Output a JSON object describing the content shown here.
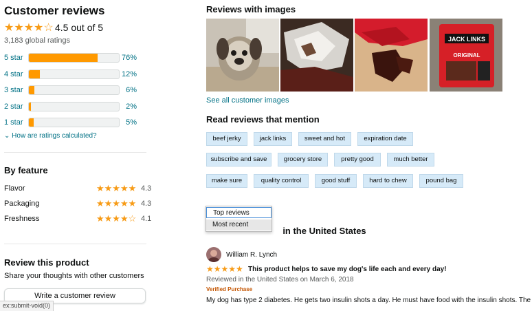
{
  "header": {
    "title": "Customer reviews"
  },
  "overall": {
    "stars_glyph": "★★★★☆",
    "text": "4.5 out of 5",
    "rating": 4.5,
    "global_ratings": "3,183 global ratings"
  },
  "histogram": [
    {
      "label": "5 star",
      "pct_text": "76%",
      "pct": 76
    },
    {
      "label": "4 star",
      "pct_text": "12%",
      "pct": 12
    },
    {
      "label": "3 star",
      "pct_text": "6%",
      "pct": 6
    },
    {
      "label": "2 star",
      "pct_text": "2%",
      "pct": 2
    },
    {
      "label": "1 star",
      "pct_text": "5%",
      "pct": 5
    }
  ],
  "how_link": "How are ratings calculated?",
  "by_feature": {
    "title": "By feature",
    "items": [
      {
        "name": "Flavor",
        "stars_glyph": "★★★★★",
        "score": "4.3"
      },
      {
        "name": "Packaging",
        "stars_glyph": "★★★★★",
        "score": "4.3"
      },
      {
        "name": "Freshness",
        "stars_glyph": "★★★★☆",
        "score": "4.1"
      }
    ]
  },
  "review_product": {
    "title": "Review this product",
    "subtitle": "Share your thoughts with other customers",
    "button": "Write a customer review"
  },
  "status_bar": {
    "text": "ex:submit-void(0)"
  },
  "images_section": {
    "title": "Reviews with images",
    "see_all": "See all customer images"
  },
  "mentions": {
    "title": "Read reviews that mention",
    "chips": [
      "beef jerky",
      "jack links",
      "sweet and hot",
      "expiration date",
      "subscribe and save",
      "grocery store",
      "pretty good",
      "much better",
      "make sure",
      "quality control",
      "good stuff",
      "hard to chew",
      "pound bag"
    ]
  },
  "sort_dropdown": {
    "options": [
      "Top reviews",
      "Most recent"
    ],
    "selected": "Top reviews"
  },
  "top_reviews_heading": "Top reviews from the United States",
  "top_reviews_visible_part": "in the United States",
  "review": {
    "reviewer": "William R. Lynch",
    "stars_glyph": "★★★★★",
    "title": "This product helps to save my dog's life each and every day!",
    "date": "Reviewed in the United States on March 6, 2018",
    "verified": "Verified Purchase",
    "body": "My dog has type 2 diabetes. He gets two insulin shots a day. He must have food with the insulin shots. The"
  },
  "colors": {
    "accent_link": "#007185",
    "star": "#f79b16",
    "bar_fill": "#ff9900",
    "chip_bg": "#d6eaf8",
    "verified": "#c45500"
  }
}
